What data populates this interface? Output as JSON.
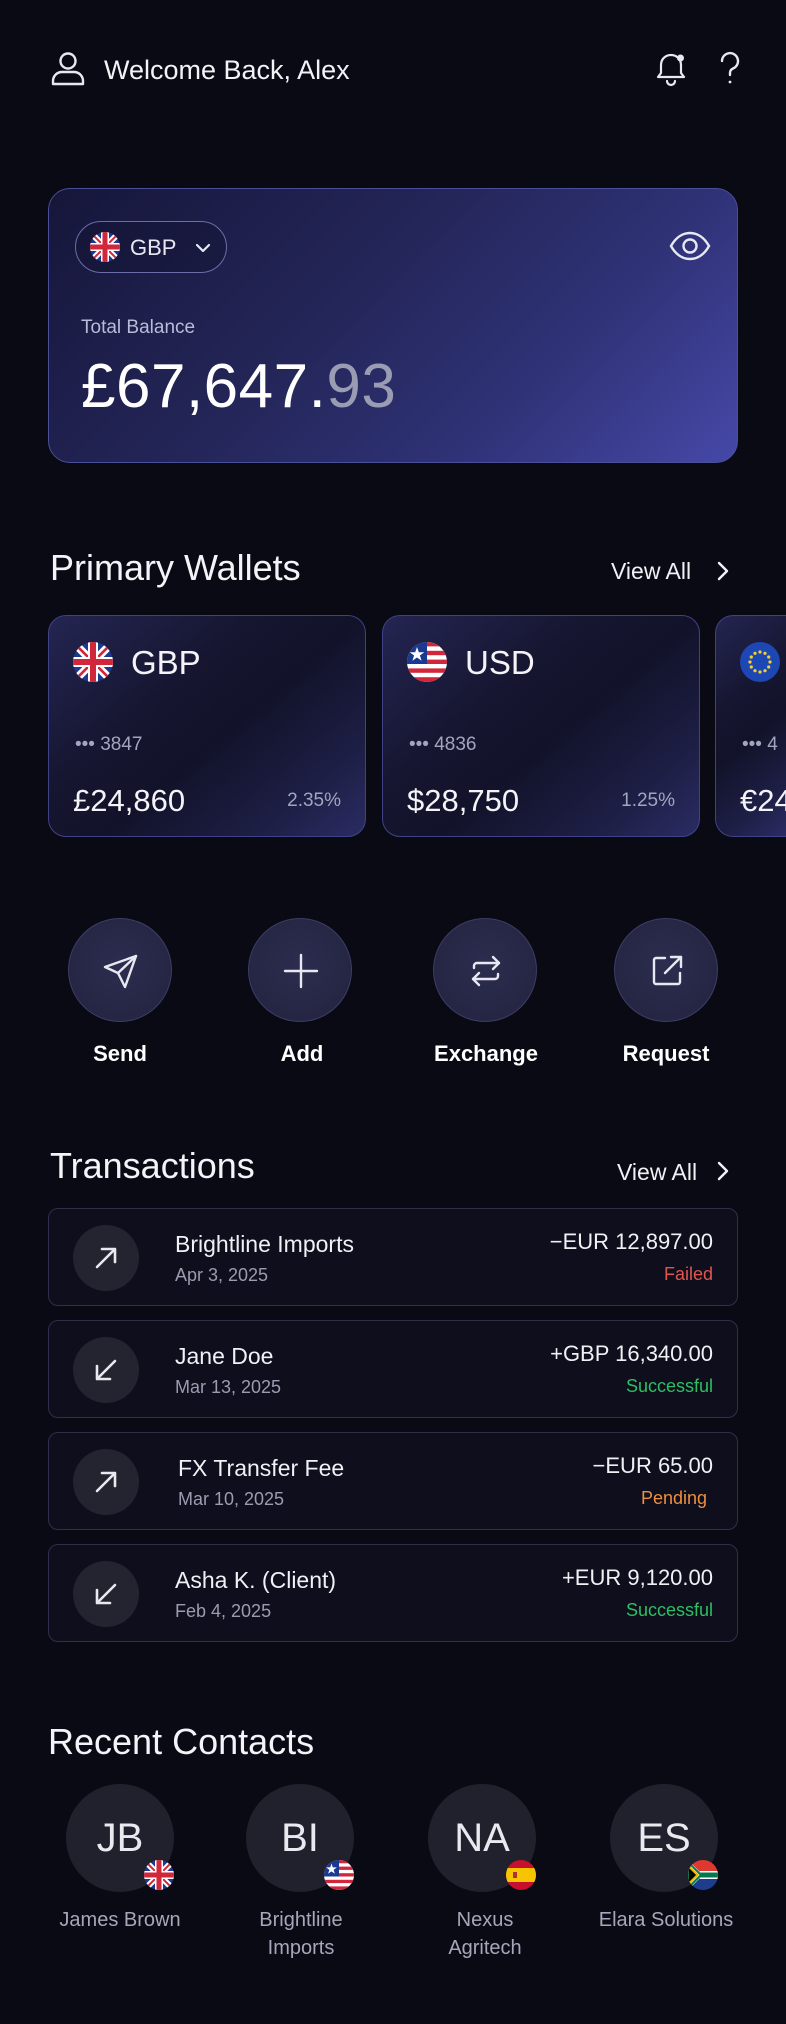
{
  "header": {
    "title": "Welcome Back, Alex",
    "icons": [
      "user-icon",
      "bell-icon",
      "help-icon"
    ]
  },
  "balance": {
    "currency": "GBP",
    "label": "Total Balance",
    "amount_whole": "£67,647.",
    "amount_cents": "93"
  },
  "wallets_section": {
    "title": "Primary Wallets",
    "view_all": "View All",
    "wallets": [
      {
        "code": "GBP",
        "masked": "••• 3847",
        "amount": "£24,860",
        "pct": "2.35%"
      },
      {
        "code": "USD",
        "masked": "••• 4836",
        "amount": "$28,750",
        "pct": "1.25%"
      },
      {
        "code": "",
        "masked": "••• 4",
        "amount": "€24",
        "pct": ""
      }
    ]
  },
  "actions": [
    {
      "label": "Send",
      "icon": "send-icon"
    },
    {
      "label": "Add",
      "icon": "plus-icon"
    },
    {
      "label": "Exchange",
      "icon": "exchange-icon"
    },
    {
      "label": "Request",
      "icon": "request-icon"
    }
  ],
  "transactions_section": {
    "title": "Transactions",
    "view_all": "View All",
    "items": [
      {
        "name": "Brightline Imports",
        "date": "Apr 3, 2025",
        "amount": "−EUR 12,897.00",
        "status": "Failed",
        "direction": "out"
      },
      {
        "name": "Jane Doe",
        "date": "Mar 13, 2025",
        "amount": "+GBP 16,340.00",
        "status": "Successful",
        "direction": "in"
      },
      {
        "name": "FX Transfer Fee",
        "date": "Mar 10, 2025",
        "amount": "−EUR 65.00",
        "status": "Pending",
        "direction": "out"
      },
      {
        "name": "Asha K. (Client)",
        "date": "Feb 4, 2025",
        "amount": "+EUR 9,120.00",
        "status": "Successful",
        "direction": "in"
      }
    ]
  },
  "contacts_section": {
    "title": "Recent Contacts",
    "contacts": [
      {
        "initials": "JB",
        "name_line1": "James Brown",
        "name_line2": "",
        "flag": "uk-flag"
      },
      {
        "initials": "BI",
        "name_line1": "Brightline",
        "name_line2": "Imports",
        "flag": "us-flag"
      },
      {
        "initials": "NA",
        "name_line1": "Nexus",
        "name_line2": "Agritech",
        "flag": "spain-flag"
      },
      {
        "initials": "ES",
        "name_line1": "Elara Solutions",
        "name_line2": "",
        "flag": "south-africa-flag"
      }
    ]
  },
  "colors": {
    "background": "#0a0a14",
    "failed": "#e0564f",
    "successful": "#2fbf63",
    "pending": "#ee8f3e",
    "accent": "#4648a8"
  }
}
